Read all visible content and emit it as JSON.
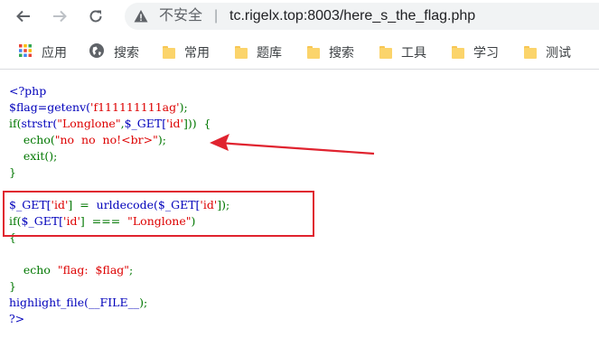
{
  "browser": {
    "insecure_label": "不安全",
    "separator": "|",
    "url": "tc.rigelx.top:8003/here_s_the_flag.php"
  },
  "bookmarks": [
    {
      "label": "应用",
      "icon": "apps-grid-icon"
    },
    {
      "label": "搜索",
      "icon": "globe-icon"
    },
    {
      "label": "常用",
      "icon": "folder-icon"
    },
    {
      "label": "题库",
      "icon": "folder-icon"
    },
    {
      "label": "搜索",
      "icon": "folder-icon"
    },
    {
      "label": "工具",
      "icon": "folder-icon"
    },
    {
      "label": "学习",
      "icon": "folder-icon"
    },
    {
      "label": "测试",
      "icon": "folder-icon"
    }
  ],
  "code": {
    "l1": "<?php",
    "l2a": "$flag=getenv(",
    "l2b": "'f111111111ag'",
    "l2c": ");",
    "l3a": "if(",
    "l3b": "strstr(",
    "l3c": "\"Longlone\"",
    "l3d": ",",
    "l3e": "$_GET[",
    "l3f": "'id'",
    "l3g": "]))  {",
    "l4a": "    echo(",
    "l4b": "\"no  no  no!<br>\"",
    "l4c": ");",
    "l5": "    exit();",
    "l6": "}",
    "l7a": "$_GET[",
    "l7b": "'id'",
    "l7c": "]  =  ",
    "l7d": "urldecode(",
    "l7e": "$_GET[",
    "l7f": "'id'",
    "l7g": "]);",
    "l8a": "if(",
    "l8b": "$_GET[",
    "l8c": "'id'",
    "l8d": "]  ===  ",
    "l8e": "\"Longlone\"",
    "l8f": ")",
    "l9": "{",
    "l10a": "    echo  ",
    "l10b": "\"flag:  $flag\"",
    "l10c": ";",
    "l11": "}",
    "l12a": "highlight_file(",
    "l12b": "__FILE__",
    "l12c": ");",
    "l13": "?>"
  },
  "colors": {
    "php_default": "#0000bb",
    "php_string": "#dd0000",
    "php_keyword": "#007700",
    "annotation_red": "#e0232f"
  }
}
